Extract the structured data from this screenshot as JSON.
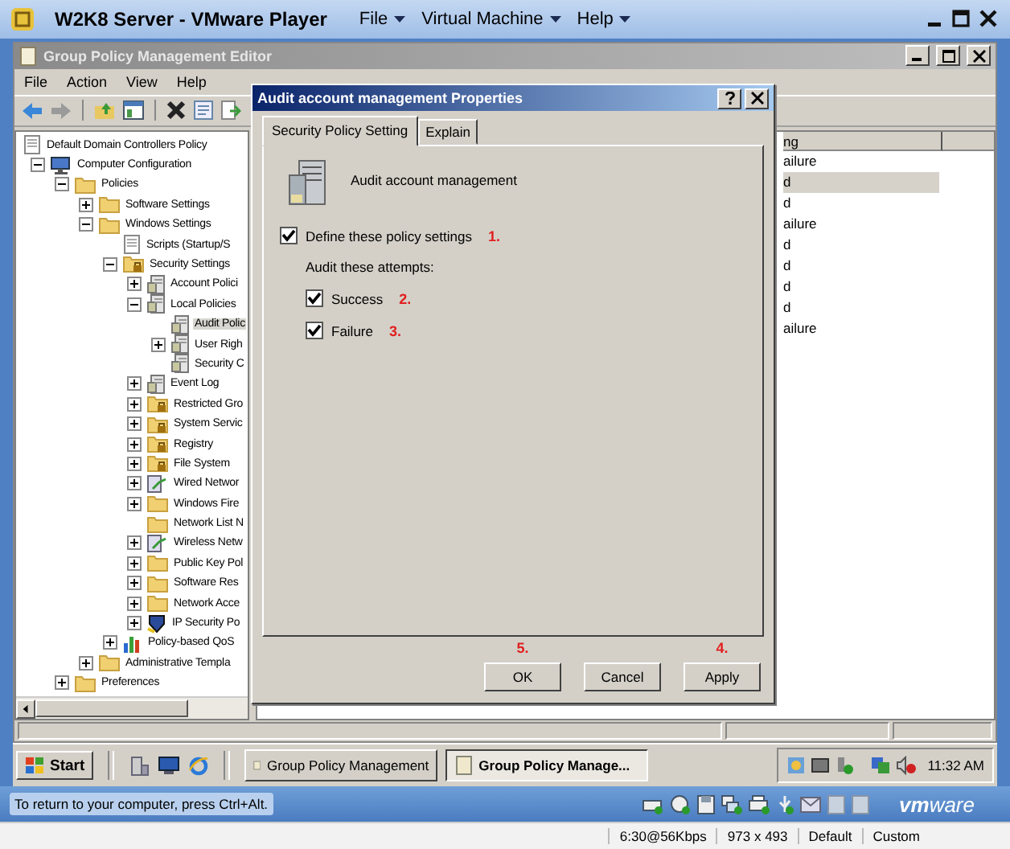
{
  "vm_window": {
    "title": "W2K8 Server - VMware Player",
    "menus": [
      "File",
      "Virtual Machine",
      "Help"
    ]
  },
  "gpme_window": {
    "title": "Group Policy Management Editor",
    "menus": [
      "File",
      "Action",
      "View",
      "Help"
    ],
    "tree": [
      {
        "label": "Default Domain Controllers Policy",
        "kind": "doc",
        "selected": false,
        "children": [
          {
            "label": "Computer Configuration",
            "kind": "computer",
            "expanded": true,
            "selected": false,
            "children": [
              {
                "label": "Policies",
                "kind": "folder",
                "expanded": true,
                "selected": false,
                "children": [
                  {
                    "label": "Software Settings",
                    "kind": "folder",
                    "expanded": false,
                    "selected": false
                  },
                  {
                    "label": "Windows Settings",
                    "kind": "folder",
                    "expanded": true,
                    "selected": false,
                    "children": [
                      {
                        "label": "Scripts (Startup/S",
                        "kind": "doc",
                        "selected": false
                      },
                      {
                        "label": "Security Settings",
                        "kind": "lockfolder",
                        "expanded": true,
                        "selected": false,
                        "children": [
                          {
                            "label": "Account Polici",
                            "kind": "policy",
                            "expanded": false,
                            "selected": false
                          },
                          {
                            "label": "Local Policies",
                            "kind": "policy",
                            "expanded": true,
                            "selected": false,
                            "children": [
                              {
                                "label": "Audit Polic",
                                "kind": "policy",
                                "selected": true
                              },
                              {
                                "label": "User Righ",
                                "kind": "policy",
                                "expanded": false,
                                "selected": false
                              },
                              {
                                "label": "Security C",
                                "kind": "policy",
                                "selected": false
                              }
                            ]
                          },
                          {
                            "label": "Event Log",
                            "kind": "policy",
                            "expanded": false,
                            "selected": false
                          },
                          {
                            "label": "Restricted Gro",
                            "kind": "lockfolder",
                            "expanded": false,
                            "selected": false
                          },
                          {
                            "label": "System Servic",
                            "kind": "lockfolder",
                            "expanded": false,
                            "selected": false
                          },
                          {
                            "label": "Registry",
                            "kind": "lockfolder",
                            "expanded": false,
                            "selected": false
                          },
                          {
                            "label": "File System",
                            "kind": "lockfolder",
                            "expanded": false,
                            "selected": false
                          },
                          {
                            "label": "Wired Networ",
                            "kind": "network",
                            "expanded": false,
                            "selected": false
                          },
                          {
                            "label": "Windows Fire",
                            "kind": "folder",
                            "expanded": false,
                            "selected": false
                          },
                          {
                            "label": "Network List N",
                            "kind": "folder",
                            "selected": false
                          },
                          {
                            "label": "Wireless Netw",
                            "kind": "network",
                            "expanded": false,
                            "selected": false
                          },
                          {
                            "label": "Public Key Pol",
                            "kind": "folder",
                            "expanded": false,
                            "selected": false
                          },
                          {
                            "label": "Software Res",
                            "kind": "folder",
                            "expanded": false,
                            "selected": false
                          },
                          {
                            "label": "Network Acce",
                            "kind": "folder",
                            "expanded": false,
                            "selected": false
                          },
                          {
                            "label": "IP Security Po",
                            "kind": "shield",
                            "expanded": false,
                            "selected": false
                          }
                        ]
                      },
                      {
                        "label": "Policy-based QoS",
                        "kind": "chart",
                        "expanded": false,
                        "selected": false
                      }
                    ]
                  },
                  {
                    "label": "Administrative Templa",
                    "kind": "folder",
                    "expanded": false,
                    "selected": false
                  }
                ]
              },
              {
                "label": "Preferences",
                "kind": "folder",
                "expanded": false,
                "selected": false
              }
            ]
          }
        ]
      }
    ],
    "list": {
      "header": "ng",
      "rows": [
        {
          "text": "ailure",
          "selected": false
        },
        {
          "text": "d",
          "selected": true
        },
        {
          "text": "d",
          "selected": false
        },
        {
          "text": "ailure",
          "selected": false
        },
        {
          "text": "d",
          "selected": false
        },
        {
          "text": "d",
          "selected": false
        },
        {
          "text": "d",
          "selected": false
        },
        {
          "text": "d",
          "selected": false
        },
        {
          "text": "ailure",
          "selected": false
        }
      ]
    }
  },
  "dialog": {
    "title": "Audit account management Properties",
    "tabs": [
      {
        "label": "Security Policy Setting",
        "selected": true
      },
      {
        "label": "Explain",
        "selected": false
      }
    ],
    "policy_name": "Audit account management",
    "define": {
      "label": "Define these policy settings",
      "checked": true,
      "annotation": "1."
    },
    "attempts_label": "Audit these attempts:",
    "attempts": [
      {
        "label": "Success",
        "checked": true,
        "annotation": "2."
      },
      {
        "label": "Failure",
        "checked": true,
        "annotation": "3."
      }
    ],
    "buttons": [
      {
        "label": "OK",
        "annotation": "5."
      },
      {
        "label": "Cancel"
      },
      {
        "label": "Apply",
        "annotation": "4."
      }
    ]
  },
  "taskbar": {
    "start": "Start",
    "tasks": [
      {
        "label": "Group Policy Management",
        "selected": false
      },
      {
        "label": "Group Policy Manage...",
        "selected": true
      }
    ],
    "clock": "11:32 AM"
  },
  "vm_status": {
    "hint": "To return to your computer, press Ctrl+Alt.",
    "logo": "**vm**ware"
  },
  "bottom_bar": [
    "6:30@56Kbps",
    "973 x 493",
    "Default",
    "Custom"
  ]
}
